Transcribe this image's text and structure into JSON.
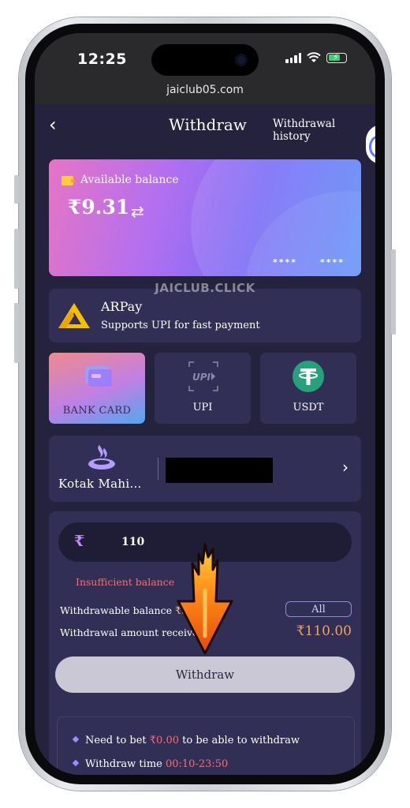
{
  "status_bar": {
    "time": "12:25",
    "url": "jaiclub05.com"
  },
  "header": {
    "back_icon": "‹",
    "title": "Withdraw",
    "history_link": "Withdrawal history"
  },
  "balance_card": {
    "label": "Available balance",
    "amount": "₹9.31",
    "card_mask_left": "****",
    "card_mask_right": "****"
  },
  "watermark": "JAICLUB.CLICK",
  "payment_provider": {
    "name": "ARPay",
    "description": "Supports UPI for fast payment"
  },
  "methods": [
    {
      "label": "BANK CARD",
      "active": true
    },
    {
      "label": "UPI",
      "active": false
    },
    {
      "label": "USDT",
      "active": false
    }
  ],
  "bank": {
    "name": "Kotak Mahi…",
    "account": "[redacted]"
  },
  "amount": {
    "currency": "₹",
    "value": "110"
  },
  "messages": {
    "insufficient": "Insufficient balance"
  },
  "info": {
    "withdrawable_label": "Withdrawable balance",
    "withdrawable_value": "₹9.31",
    "all_label": "All",
    "received_label": "Withdrawal amount received",
    "received_value": "₹110.00"
  },
  "withdraw_button": "Withdraw",
  "rules": {
    "bet_prefix": "Need to bet",
    "bet_value": "₹0.00",
    "bet_suffix": "to be able to withdraw",
    "time_prefix": "Withdraw time",
    "time_value": "00:10-23:50"
  },
  "colors": {
    "accent_purple": "#c389ff",
    "error_red": "#ff6b6b",
    "amount_orange": "#f3a25b",
    "bg": "#24223d",
    "card_bg": "#312f55"
  }
}
